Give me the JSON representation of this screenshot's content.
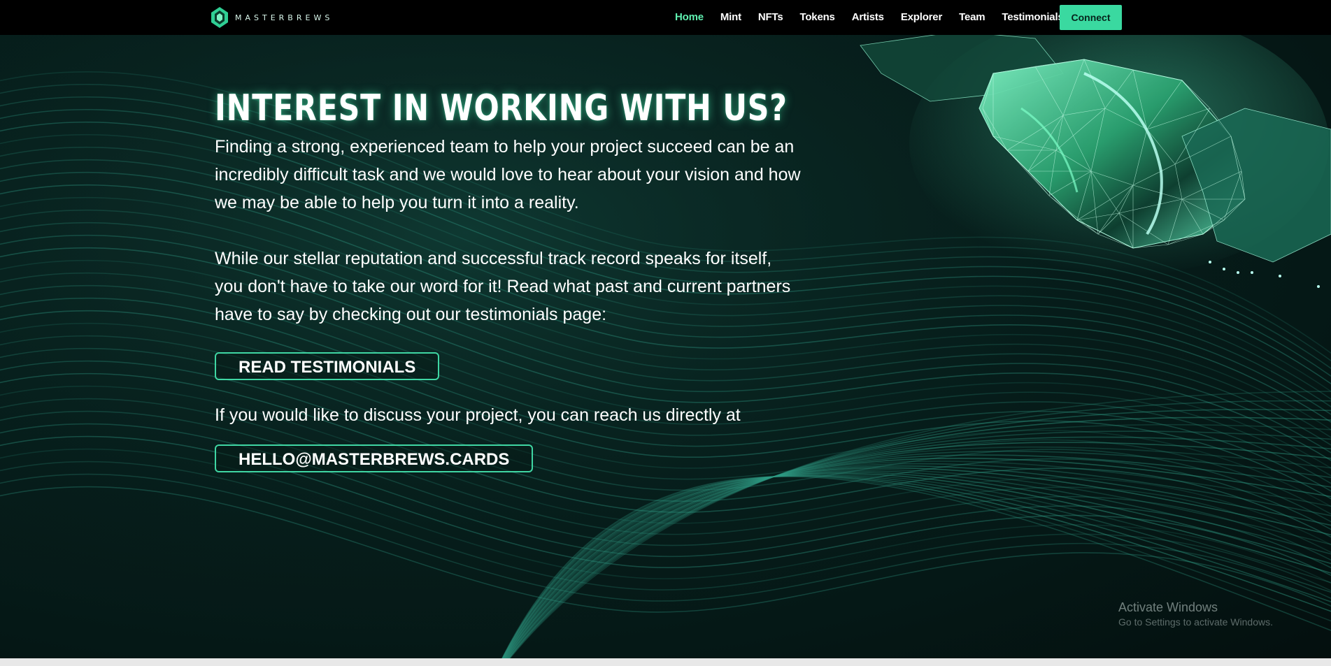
{
  "brand": {
    "name": "MASTERBREWS"
  },
  "nav": {
    "items": [
      {
        "label": "Home",
        "active": true
      },
      {
        "label": "Mint",
        "active": false
      },
      {
        "label": "NFTs",
        "active": false
      },
      {
        "label": "Tokens",
        "active": false
      },
      {
        "label": "Artists",
        "active": false
      },
      {
        "label": "Explorer",
        "active": false
      },
      {
        "label": "Team",
        "active": false
      },
      {
        "label": "Testimonials",
        "active": false
      }
    ],
    "connect_label": "Connect"
  },
  "hero": {
    "headline": "INTEREST IN WORKING WITH US?",
    "paragraph1": "Finding a strong, experienced team to help your project succeed can be an incredibly difficult task and we would love to hear about your vision and how we may be able to help you turn it into a reality.",
    "paragraph2": "While our stellar reputation and successful track record speaks for itself, you don't have to take our word for it! Read what past and current partners have to say by checking out our testimonials page:",
    "testimonials_button": "READ TESTIMONIALS",
    "paragraph3": "If you would like to discuss your project, you can reach us directly at",
    "email_button": "HELLO@MASTERBREWS.CARDS"
  },
  "watermark": {
    "title": "Activate Windows",
    "subtitle": "Go to Settings to activate Windows."
  },
  "colors": {
    "accent": "#3ad9a0",
    "active_nav": "#5ff0b0",
    "background": "#07211e",
    "wave_lines": "#2f9c85"
  }
}
